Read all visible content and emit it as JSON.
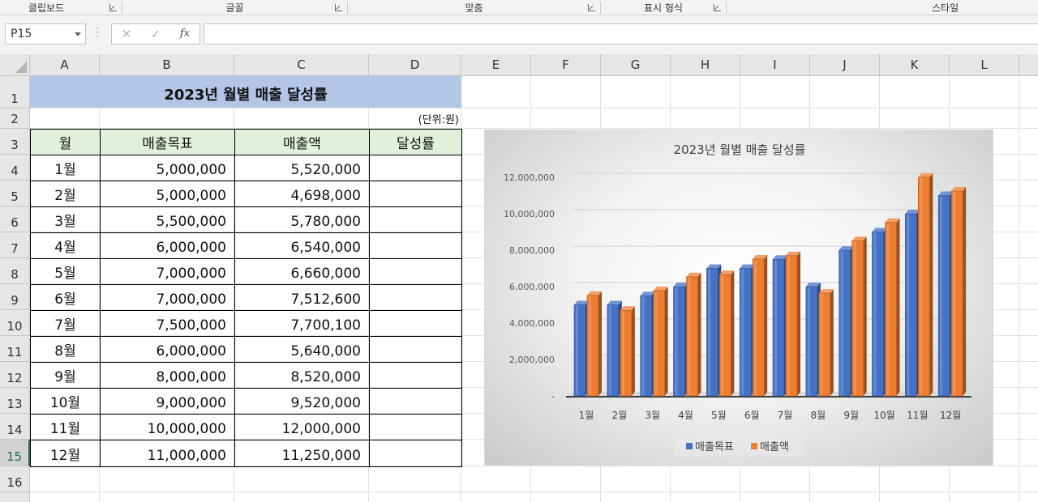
{
  "ribbon": {
    "groups": [
      {
        "label": "클립보드"
      },
      {
        "label": "글꼴"
      },
      {
        "label": "맞춤"
      },
      {
        "label": "표시 형식"
      },
      {
        "label": "스타일"
      }
    ]
  },
  "formula_bar": {
    "name_box": "P15",
    "cancel_icon": "✕",
    "enter_icon": "✓",
    "fx_label": "fx",
    "formula": ""
  },
  "grid": {
    "columns": [
      "A",
      "B",
      "C",
      "D",
      "E",
      "F",
      "G",
      "H",
      "I",
      "J",
      "K",
      "L"
    ],
    "rows": [
      "1",
      "2",
      "3",
      "4",
      "5",
      "6",
      "7",
      "8",
      "9",
      "10",
      "11",
      "12",
      "13",
      "14",
      "15",
      "16"
    ],
    "selected_row": "15"
  },
  "sheet": {
    "title": "2023년 월별 매출 달성률",
    "unit": "(단위:원)",
    "headers": [
      "월",
      "매출목표",
      "매출액",
      "달성률"
    ],
    "rows": [
      {
        "month": "1월",
        "target": "5,000,000",
        "sales": "5,520,000",
        "rate": ""
      },
      {
        "month": "2월",
        "target": "5,000,000",
        "sales": "4,698,000",
        "rate": ""
      },
      {
        "month": "3월",
        "target": "5,500,000",
        "sales": "5,780,000",
        "rate": ""
      },
      {
        "month": "4월",
        "target": "6,000,000",
        "sales": "6,540,000",
        "rate": ""
      },
      {
        "month": "5월",
        "target": "7,000,000",
        "sales": "6,660,000",
        "rate": ""
      },
      {
        "month": "6월",
        "target": "7,000,000",
        "sales": "7,512,600",
        "rate": ""
      },
      {
        "month": "7월",
        "target": "7,500,000",
        "sales": "7,700,100",
        "rate": ""
      },
      {
        "month": "8월",
        "target": "6,000,000",
        "sales": "5,640,000",
        "rate": ""
      },
      {
        "month": "9월",
        "target": "8,000,000",
        "sales": "8,520,000",
        "rate": ""
      },
      {
        "month": "10월",
        "target": "9,000,000",
        "sales": "9,520,000",
        "rate": ""
      },
      {
        "month": "11월",
        "target": "10,000,000",
        "sales": "12,000,000",
        "rate": ""
      },
      {
        "month": "12월",
        "target": "11,000,000",
        "sales": "11,250,000",
        "rate": ""
      }
    ]
  },
  "chart_data": {
    "type": "bar",
    "title": "2023년 월별 매출 달성률",
    "categories": [
      "1월",
      "2월",
      "3월",
      "4월",
      "5월",
      "6월",
      "7월",
      "8월",
      "9월",
      "10월",
      "11월",
      "12월"
    ],
    "series": [
      {
        "name": "매출목표",
        "values": [
          5000000,
          5000000,
          5500000,
          6000000,
          7000000,
          7000000,
          7500000,
          6000000,
          8000000,
          9000000,
          10000000,
          11000000
        ],
        "color": "#4472c4"
      },
      {
        "name": "매출액",
        "values": [
          5520000,
          4698000,
          5780000,
          6540000,
          6660000,
          7512600,
          7700100,
          5640000,
          8520000,
          9520000,
          12000000,
          11250000
        ],
        "color": "#ed7d31"
      }
    ],
    "y_ticks": [
      "-",
      "2,000,000",
      "4,000,000",
      "6,000,000",
      "8,000,000",
      "10,000,000",
      "12,000,000"
    ],
    "ylim": [
      0,
      12000000
    ],
    "grid": true,
    "style": "3d-clustered-column",
    "legend_position": "bottom"
  }
}
